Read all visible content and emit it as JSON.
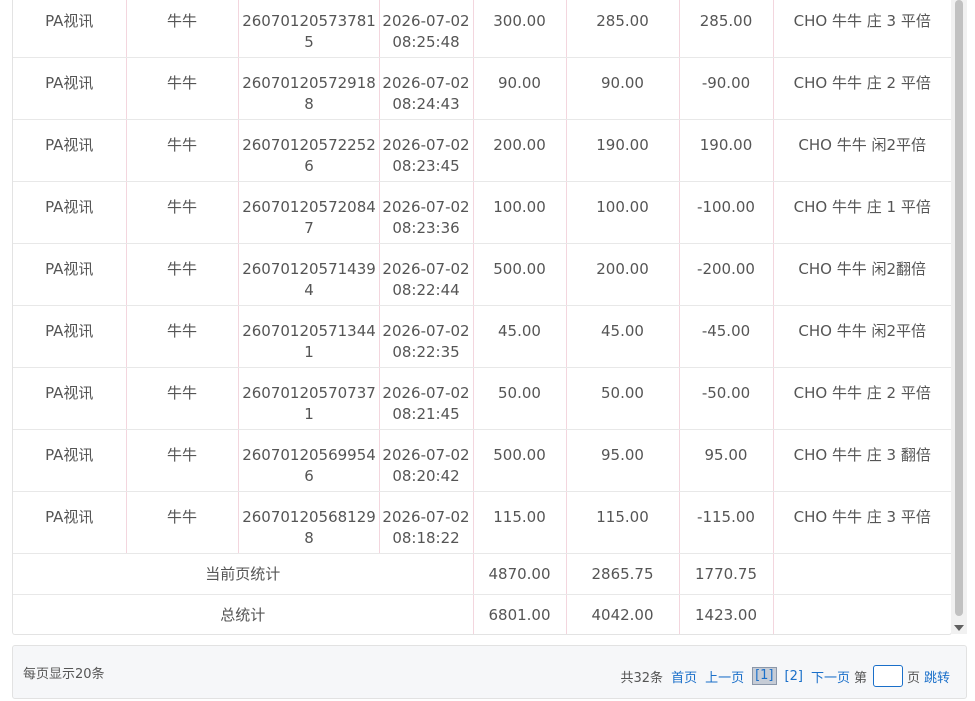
{
  "rows": [
    {
      "platform": "PA视讯",
      "game": "牛牛",
      "serial": "260701205737815",
      "time": "2026-07-02 08:25:48",
      "bet": "300.00",
      "valid": "285.00",
      "win": "285.00",
      "remark": "CHO 牛牛 庄 3 平倍"
    },
    {
      "platform": "PA视讯",
      "game": "牛牛",
      "serial": "260701205729188",
      "time": "2026-07-02 08:24:43",
      "bet": "90.00",
      "valid": "90.00",
      "win": "-90.00",
      "remark": "CHO 牛牛 庄 2 平倍"
    },
    {
      "platform": "PA视讯",
      "game": "牛牛",
      "serial": "260701205722526",
      "time": "2026-07-02 08:23:45",
      "bet": "200.00",
      "valid": "190.00",
      "win": "190.00",
      "remark": "CHO 牛牛 闲2平倍"
    },
    {
      "platform": "PA视讯",
      "game": "牛牛",
      "serial": "260701205720847",
      "time": "2026-07-02 08:23:36",
      "bet": "100.00",
      "valid": "100.00",
      "win": "-100.00",
      "remark": "CHO 牛牛 庄 1 平倍"
    },
    {
      "platform": "PA视讯",
      "game": "牛牛",
      "serial": "260701205714394",
      "time": "2026-07-02 08:22:44",
      "bet": "500.00",
      "valid": "200.00",
      "win": "-200.00",
      "remark": "CHO 牛牛 闲2翻倍"
    },
    {
      "platform": "PA视讯",
      "game": "牛牛",
      "serial": "260701205713441",
      "time": "2026-07-02 08:22:35",
      "bet": "45.00",
      "valid": "45.00",
      "win": "-45.00",
      "remark": "CHO 牛牛 闲2平倍"
    },
    {
      "platform": "PA视讯",
      "game": "牛牛",
      "serial": "260701205707371",
      "time": "2026-07-02 08:21:45",
      "bet": "50.00",
      "valid": "50.00",
      "win": "-50.00",
      "remark": "CHO 牛牛 庄 2 平倍"
    },
    {
      "platform": "PA视讯",
      "game": "牛牛",
      "serial": "260701205699546",
      "time": "2026-07-02 08:20:42",
      "bet": "500.00",
      "valid": "95.00",
      "win": "95.00",
      "remark": "CHO 牛牛 庄 3 翻倍"
    },
    {
      "platform": "PA视讯",
      "game": "牛牛",
      "serial": "260701205681298",
      "time": "2026-07-02 08:18:22",
      "bet": "115.00",
      "valid": "115.00",
      "win": "-115.00",
      "remark": "CHO 牛牛 庄 3 平倍"
    }
  ],
  "summary": {
    "page_label": "当前页统计",
    "page_bet": "4870.00",
    "page_valid": "2865.75",
    "page_win": "1770.75",
    "total_label": "总统计",
    "total_bet": "6801.00",
    "total_valid": "4042.00",
    "total_win": "1423.00"
  },
  "footer": {
    "per_page": "每页显示20条",
    "total_count": "共32条",
    "first": "首页",
    "prev": "上一页",
    "page1": "[1]",
    "page2": "[2]",
    "next": "下一页",
    "goto_prefix": "第",
    "goto_suffix": "页",
    "goto_button": "跳转"
  },
  "colors": {
    "link": "#1a6fc9",
    "row_divider": "#f3d6de"
  }
}
